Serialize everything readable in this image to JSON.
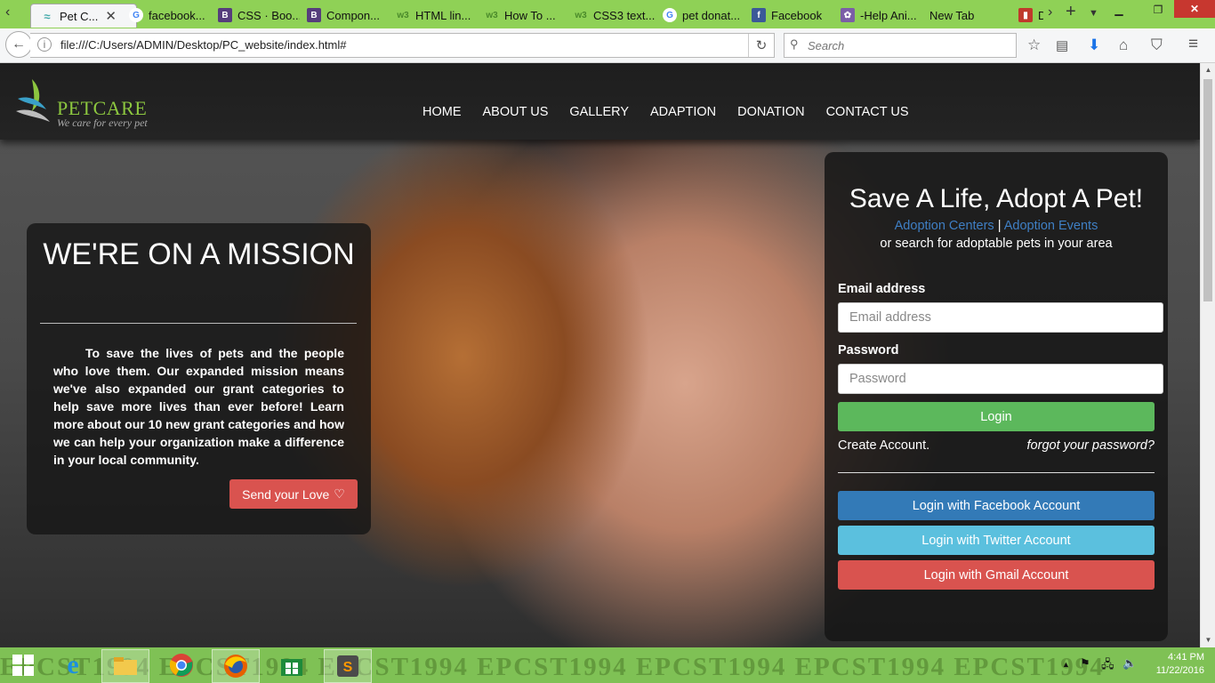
{
  "browser": {
    "tabs": [
      {
        "label": "Pet C...",
        "icon": "petcare-favicon",
        "active": true
      },
      {
        "label": "facebook...",
        "icon": "google-icon"
      },
      {
        "label": "CSS · Boo...",
        "icon": "bootstrap-icon"
      },
      {
        "label": "Compon...",
        "icon": "bootstrap-icon"
      },
      {
        "label": "HTML lin...",
        "icon": "w3schools-icon"
      },
      {
        "label": "How To ...",
        "icon": "w3schools-icon"
      },
      {
        "label": "CSS3 text...",
        "icon": "w3schools-icon"
      },
      {
        "label": "pet donat...",
        "icon": "google-icon"
      },
      {
        "label": "Facebook",
        "icon": "facebook-icon"
      },
      {
        "label": "-Help Ani...",
        "icon": "paw-icon"
      },
      {
        "label": "New Tab",
        "icon": ""
      },
      {
        "label": "D",
        "icon": "red-icon"
      }
    ],
    "url": "file:///C:/Users/ADMIN/Desktop/PC_website/index.html#",
    "search_placeholder": "Search"
  },
  "site": {
    "logo": {
      "brand": "PETCARE",
      "tagline": "We care for every pet"
    },
    "nav": [
      "HOME",
      "ABOUT US",
      "GALLERY",
      "ADAPTION",
      "DONATION",
      "CONTACT US"
    ],
    "mission": {
      "title": "WE'RE ON A MISSION",
      "body": "To save the lives of pets and the people who love them. Our expanded mission means we've also expanded our grant categories to help save more lives than ever before! Learn more about our 10 new grant categories and how we can help your organization make a difference in your local community.",
      "button": "Send your Love"
    },
    "adopt": {
      "title": "Save A Life, Adopt A Pet!",
      "link_centers": "Adoption Centers",
      "separator": "|",
      "link_events": "Adoption Events",
      "subtitle": "or search for adoptable pets in your area",
      "email_label": "Email address",
      "email_placeholder": "Email address",
      "password_label": "Password",
      "password_placeholder": "Password",
      "login": "Login",
      "create": "Create Account.",
      "forgot": "forgot your password?",
      "facebook": "Login with Facebook Account",
      "twitter": "Login with Twitter Account",
      "gmail": "Login with Gmail Account"
    }
  },
  "taskbar": {
    "watermark": "EPCST1994  EPCST1994  EPCST1994  EPCST1994  EPCST1994  EPCST1994  EPCST1994",
    "time": "4:41 PM",
    "date": "11/22/2016"
  },
  "colors": {
    "accent_green": "#5cb85c",
    "facebook_blue": "#337ab7",
    "twitter_blue": "#5bc0de",
    "gmail_red": "#d9534f",
    "link_blue": "#3f7fc4",
    "brand_green": "#8cc63f"
  }
}
